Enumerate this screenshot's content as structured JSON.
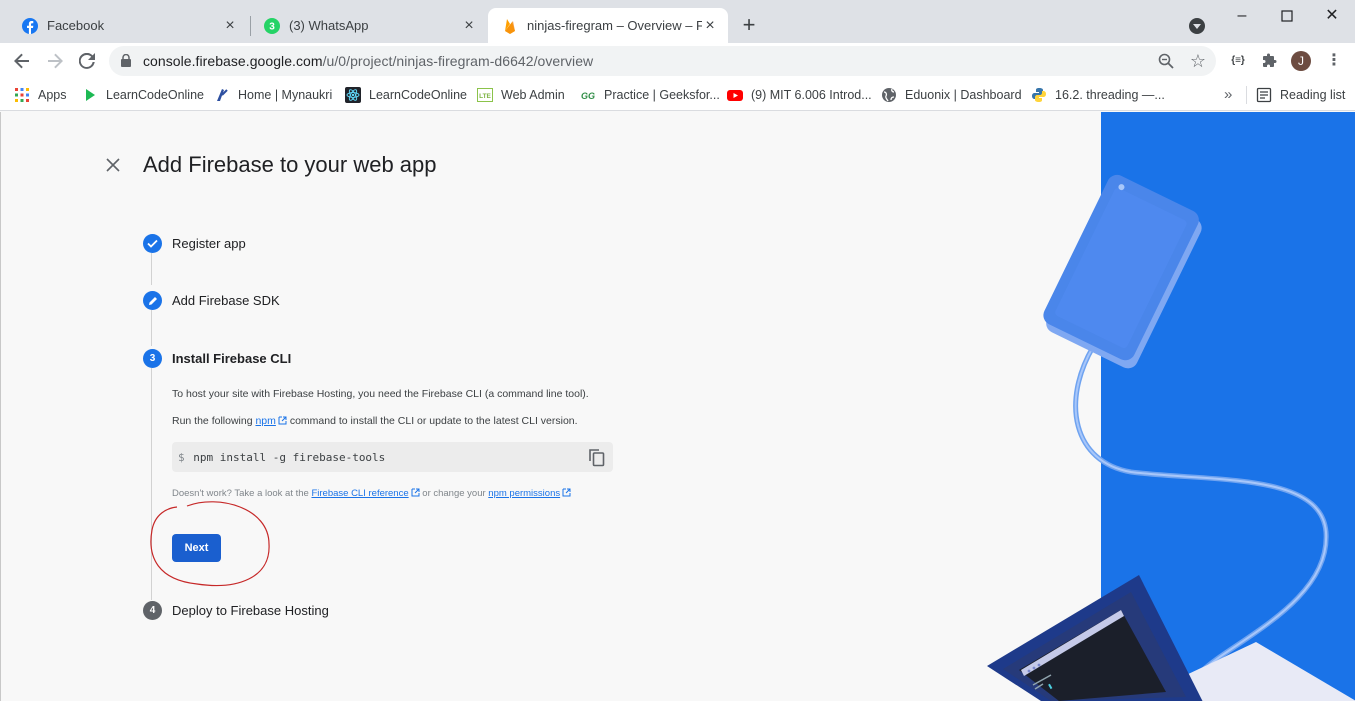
{
  "browser": {
    "tabs": [
      {
        "title": "Facebook",
        "icon": "facebook-icon",
        "active": false
      },
      {
        "title": "(3) WhatsApp",
        "icon": "whatsapp-icon",
        "badge": "3",
        "active": false
      },
      {
        "title": "ninjas-firegram – Overview – Fire",
        "icon": "firebase-icon",
        "active": true
      }
    ],
    "url_host": "console.firebase.google.com",
    "url_path": "/u/0/project/ninjas-firegram-d6642/overview",
    "avatar_letter": "J",
    "extension_label": "{≡}",
    "bookmarks": [
      {
        "label": "Apps",
        "icon": "apps-grid-icon"
      },
      {
        "label": "LearnCodeOnline",
        "icon": "play-triangle-icon"
      },
      {
        "label": "Home | Mynaukri",
        "icon": "mynaukri-icon"
      },
      {
        "label": "LearnCodeOnline",
        "icon": "react-atom-icon"
      },
      {
        "label": "Web Admin",
        "icon": "lte-icon",
        "icon_text": "LTE"
      },
      {
        "label": "Practice | Geeksfor...",
        "icon": "geeksforgeeks-icon",
        "icon_text": "GG"
      },
      {
        "label": "(9) MIT 6.006 Introd...",
        "icon": "youtube-icon"
      },
      {
        "label": "Eduonix | Dashboard",
        "icon": "globe-icon"
      },
      {
        "label": "16.2. threading —...",
        "icon": "python-icon"
      }
    ],
    "reading_list": "Reading list"
  },
  "page": {
    "title": "Add Firebase to your web app",
    "steps": [
      {
        "number": "1",
        "label": "Register app",
        "state": "done"
      },
      {
        "number": "2",
        "label": "Add Firebase SDK",
        "state": "editing"
      },
      {
        "number": "3",
        "label": "Install Firebase CLI",
        "state": "current"
      },
      {
        "number": "4",
        "label": "Deploy to Firebase Hosting",
        "state": "pending"
      }
    ],
    "install": {
      "intro": "To host your site with Firebase Hosting, you need the Firebase CLI (a command line tool).",
      "run_prefix": "Run the following ",
      "run_link": "npm",
      "run_suffix": " command to install the CLI or update to the latest CLI version.",
      "prompt": "$",
      "command": "npm install -g firebase-tools",
      "help_prefix": "Doesn't work? Take a look at the ",
      "help_link1": "Firebase CLI reference",
      "help_mid": " or change your ",
      "help_link2": "npm permissions",
      "next_label": "Next"
    },
    "colors": {
      "accent": "#1a73e8",
      "button": "#1a5fcf",
      "annotation": "#c62828"
    }
  }
}
